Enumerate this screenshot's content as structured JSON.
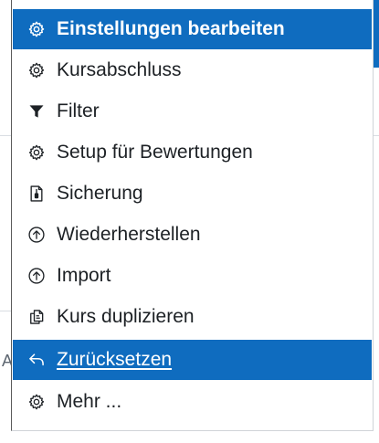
{
  "background": {
    "fragment_letter": "A"
  },
  "menu": {
    "items": [
      {
        "label": "Einstellungen bearbeiten",
        "icon": "gear-icon",
        "state": "highlighted"
      },
      {
        "label": "Kursabschluss",
        "icon": "gear-icon",
        "state": "normal"
      },
      {
        "label": "Filter",
        "icon": "filter-icon",
        "state": "normal"
      },
      {
        "label": "Setup für Bewertungen",
        "icon": "gear-icon",
        "state": "normal"
      },
      {
        "label": "Sicherung",
        "icon": "backup-file-icon",
        "state": "normal"
      },
      {
        "label": "Wiederherstellen",
        "icon": "upload-circle-icon",
        "state": "normal"
      },
      {
        "label": "Import",
        "icon": "upload-circle-icon",
        "state": "normal"
      },
      {
        "label": "Kurs duplizieren",
        "icon": "copy-icon",
        "state": "normal"
      },
      {
        "label": "Zurücksetzen",
        "icon": "reply-arrow-icon",
        "state": "selected"
      },
      {
        "label": "Mehr ...",
        "icon": "gear-icon",
        "state": "normal"
      }
    ]
  },
  "colors": {
    "accent": "#0f6cbf",
    "text": "#1d2125",
    "active_text": "#ffffff"
  }
}
